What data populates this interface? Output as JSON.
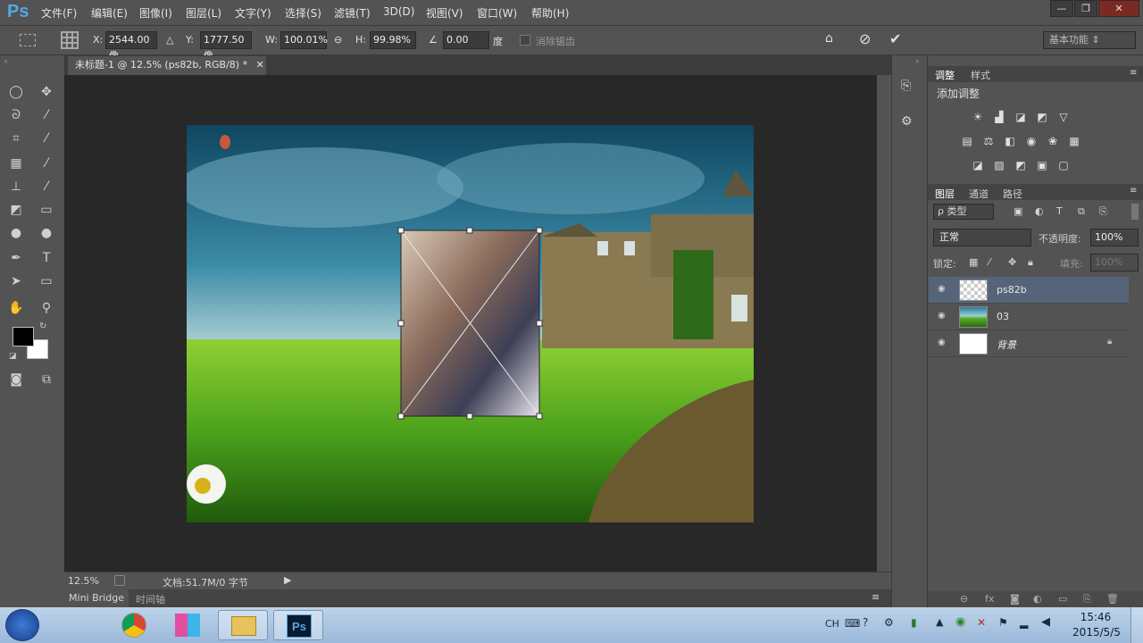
{
  "app": {
    "logo": "Ps"
  },
  "menu": [
    "文件(F)",
    "编辑(E)",
    "图像(I)",
    "图层(L)",
    "文字(Y)",
    "选择(S)",
    "滤镜(T)",
    "3D(D)",
    "视图(V)",
    "窗口(W)",
    "帮助(H)"
  ],
  "window_buttons": {
    "minimize": "—",
    "restore": "❐",
    "close": "✕"
  },
  "options": {
    "x_label": "X:",
    "x_value": "2544.00 像",
    "y_label": "Y:",
    "y_value": "1777.50 像",
    "w_label": "W:",
    "w_value": "100.01%",
    "h_label": "H:",
    "h_value": "99.98%",
    "angle_value": "0.00",
    "angle_unit": "度",
    "antialias_label": "消除锯齿",
    "workspace": "基本功能"
  },
  "document": {
    "tab_title": "未标题-1 @ 12.5% (ps82b, RGB/8) *"
  },
  "status": {
    "zoom": "12.5%",
    "doc_info": "文档:51.7M/0 字节"
  },
  "bottom_tabs": [
    "Mini Bridge",
    "时间轴"
  ],
  "adjust_panel": {
    "tabs": [
      "调整",
      "样式"
    ],
    "title": "添加调整"
  },
  "layers_panel": {
    "tabs": [
      "图层",
      "通道",
      "路径"
    ],
    "filter_label": "ρ 类型",
    "blend_mode": "正常",
    "opacity_label": "不透明度:",
    "opacity_value": "100%",
    "lock_label": "锁定:",
    "fill_label": "填充:",
    "fill_value": "100%",
    "layers": [
      {
        "name": "ps82b",
        "selected": true
      },
      {
        "name": "03",
        "selected": false
      },
      {
        "name": "背景",
        "selected": false
      }
    ]
  },
  "taskbar": {
    "ime": "CH",
    "time": "15:46",
    "date": "2015/5/5"
  },
  "colors": {
    "accent": "#4fa8e8",
    "selected_layer": "#56647a"
  }
}
